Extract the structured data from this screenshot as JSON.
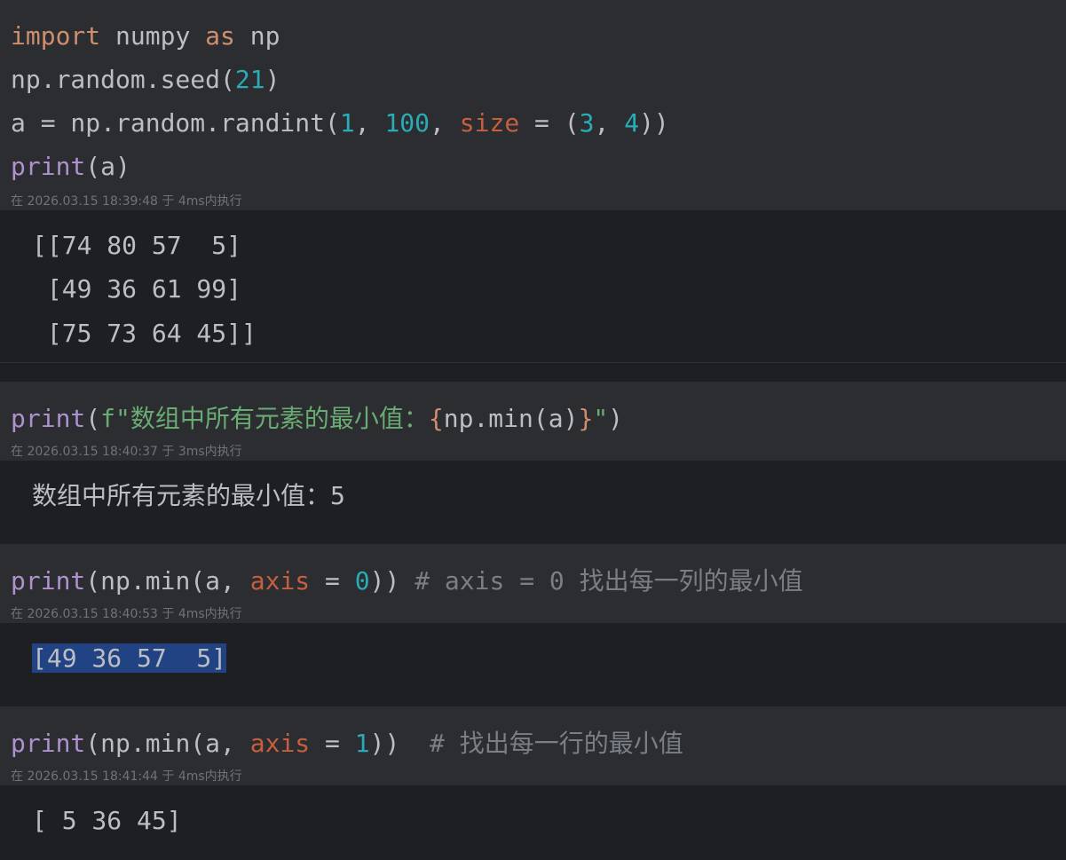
{
  "cells": [
    {
      "code": [
        [
          "import",
          " numpy ",
          "as",
          " np"
        ],
        [
          "np.random.seed(",
          "21",
          ")"
        ],
        [
          "a = np.random.randint(",
          "1",
          ", ",
          "100",
          ", ",
          "size",
          " = (",
          "3",
          ", ",
          "4",
          "))"
        ],
        [
          "print",
          "(a)"
        ]
      ],
      "meta": "在 2026.03.15 18:39:48 于 4ms内执行",
      "output": [
        "[[74 80 57  5]",
        " [49 36 61 99]",
        " [75 73 64 45]]"
      ]
    },
    {
      "code": [
        [
          "print",
          "(",
          "f\"数组中所有元素的最小值：",
          "{",
          "np.min(a)",
          "}",
          "\"",
          ")"
        ]
      ],
      "meta": "在 2026.03.15 18:40:37 于 3ms内执行",
      "output": [
        "数组中所有元素的最小值：5"
      ]
    },
    {
      "code": [
        [
          "print",
          "(np.min(a, ",
          "axis",
          " = ",
          "0",
          ")) ",
          "# axis = 0 找出每一列的最小值"
        ]
      ],
      "meta": "在 2026.03.15 18:40:53 于 4ms内执行",
      "output": [
        "[49 36 57  5]"
      ]
    },
    {
      "code": [
        [
          "print",
          "(np.min(a, ",
          "axis",
          " = ",
          "1",
          "))  ",
          "# 找出每一行的最小值"
        ]
      ],
      "meta": "在 2026.03.15 18:41:44 于 4ms内执行",
      "output": [
        "[ 5 36 45]"
      ]
    }
  ]
}
